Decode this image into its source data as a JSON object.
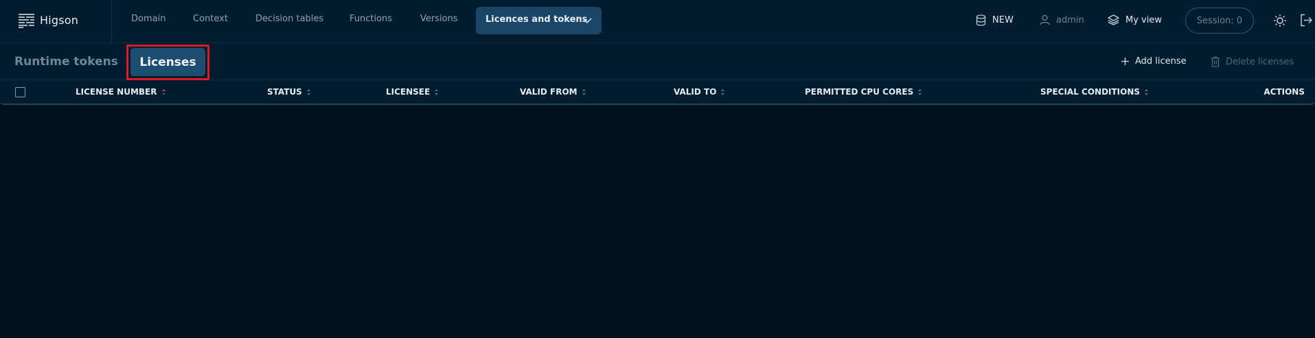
{
  "app": {
    "brand": "Higson"
  },
  "nav": {
    "items": [
      "Domain",
      "Context",
      "Decision tables",
      "Functions",
      "Versions"
    ],
    "active": "Licences and tokens"
  },
  "header_right": {
    "database_label": "NEW",
    "user_label": "admin",
    "view_label": "My view",
    "session_label": "Session: 0"
  },
  "subtabs": {
    "inactive": "Runtime tokens",
    "active": "Licenses"
  },
  "actions": {
    "add_label": "Add license",
    "delete_label": "Delete licenses"
  },
  "table": {
    "columns": [
      "LICENSE NUMBER",
      "STATUS",
      "LICENSEE",
      "VALID FROM",
      "VALID TO",
      "PERMITTED CPU CORES",
      "SPECIAL CONDITIONS",
      "ACTIONS"
    ],
    "sorted_column": "LICENSE NUMBER",
    "rows": []
  },
  "colors": {
    "background": "#01111d",
    "bar": "#011c2f",
    "active_tab": "#1a4566",
    "highlight": "#e01a22",
    "sort_active": "#e0336f"
  },
  "icons": [
    "menu-logo-icon",
    "chevron-down-icon",
    "database-icon",
    "user-icon",
    "layers-icon",
    "sun-icon",
    "logout-icon",
    "plus-icon",
    "trash-icon",
    "sort-icon"
  ]
}
